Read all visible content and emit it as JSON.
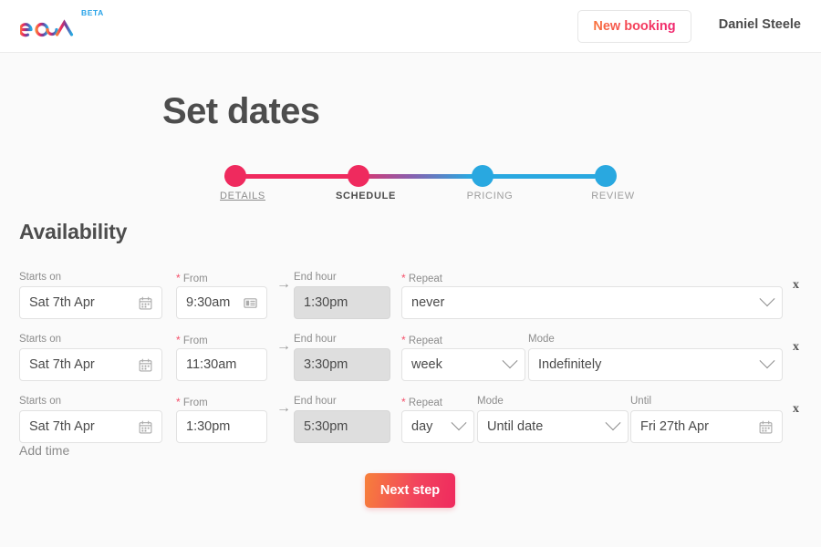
{
  "header": {
    "logo_text": "eola",
    "logo_badge": "BETA",
    "new_booking_label": "New booking",
    "user_name": "Daniel Steele"
  },
  "page": {
    "title": "Set dates",
    "section_title": "Availability",
    "add_time_label": "Add time",
    "next_step_label": "Next step"
  },
  "stepper": {
    "steps": [
      {
        "label": "DETAILS",
        "state": "done",
        "color": "#ef2a5e"
      },
      {
        "label": "SCHEDULE",
        "state": "current",
        "color": "#ef2a5e"
      },
      {
        "label": "PRICING",
        "state": "todo",
        "color": "#29a8e0"
      },
      {
        "label": "REVIEW",
        "state": "todo",
        "color": "#29a8e0"
      }
    ]
  },
  "labels": {
    "starts_on": "Starts on",
    "from": "From",
    "end_hour": "End hour",
    "repeat": "Repeat",
    "mode": "Mode",
    "until": "Until",
    "required_marker": "*",
    "arrow": "→",
    "remove": "x"
  },
  "rows": [
    {
      "starts_on": "Sat 7th Apr",
      "from": "9:30am",
      "end_hour": "1:30pm",
      "repeat": "never",
      "mode": null,
      "until": null,
      "from_icon": "time-picker-icon"
    },
    {
      "starts_on": "Sat 7th Apr",
      "from": "11:30am",
      "end_hour": "3:30pm",
      "repeat": "week",
      "mode": "Indefinitely",
      "until": null,
      "from_icon": null
    },
    {
      "starts_on": "Sat 7th Apr",
      "from": "1:30pm",
      "end_hour": "5:30pm",
      "repeat": "day",
      "mode": "Until date",
      "until": "Fri 27th Apr",
      "from_icon": null
    }
  ],
  "colors": {
    "accent_pink": "#ef2a5e",
    "accent_blue": "#29a8e0",
    "accent_orange": "#f7803a",
    "page_bg": "#fafafa"
  }
}
